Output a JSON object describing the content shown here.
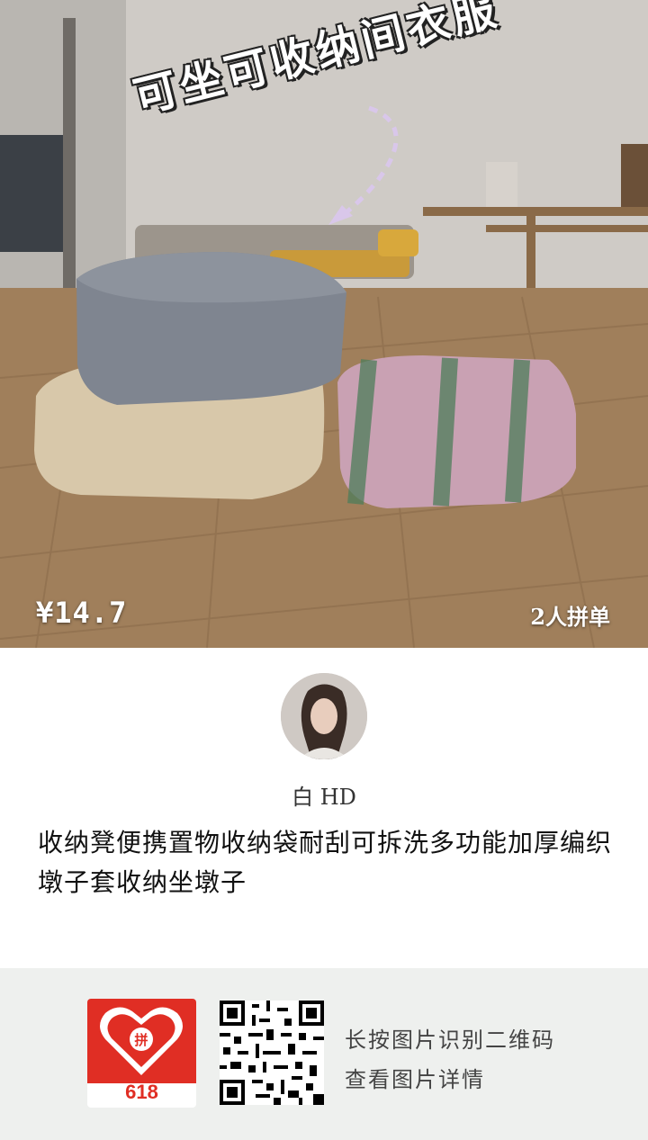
{
  "hero": {
    "overlay_text": "可坐可收纳间衣服",
    "price": "¥14.7",
    "group_buy": "2人拼单"
  },
  "seller": {
    "name": "白 HD"
  },
  "product": {
    "title": "收纳凳便携置物收纳袋耐刮可拆洗多功能加厚编织墩子套收纳坐墩子"
  },
  "footer": {
    "logo_badge": "618",
    "hint_line1": "长按图片识别二维码",
    "hint_line2": "查看图片详情"
  },
  "colors": {
    "brand_red": "#e02e24",
    "footer_bg": "#eef0ee"
  }
}
